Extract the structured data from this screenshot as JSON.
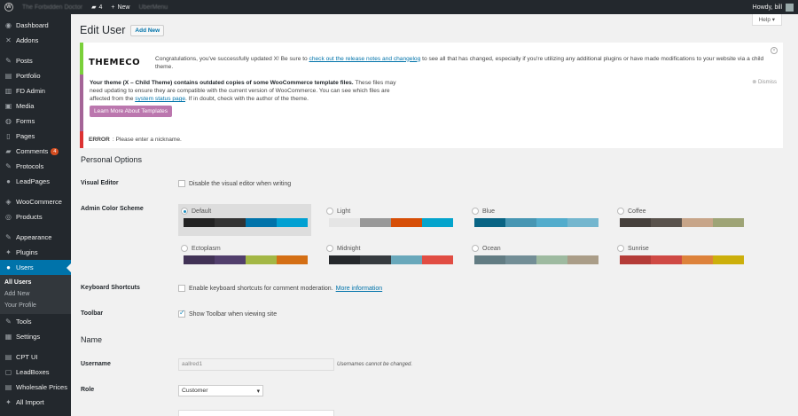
{
  "adminbar": {
    "site_name": "The Forbidden Doctor",
    "comments_count": "4",
    "new_label": "New",
    "blurred_item": "UberMenu",
    "greeting": "Howdy, bill"
  },
  "sidebar": {
    "items": [
      {
        "label": "Dashboard",
        "icon": "dashboard-icon",
        "glyph": "◉"
      },
      {
        "label": "Addons",
        "icon": "x-icon",
        "glyph": "✕"
      },
      {
        "label": "Posts",
        "icon": "pin-icon",
        "glyph": "✎"
      },
      {
        "label": "Portfolio",
        "icon": "portfolio-icon",
        "glyph": "▤"
      },
      {
        "label": "FD Admin",
        "icon": "fd-admin-icon",
        "glyph": "▥"
      },
      {
        "label": "Media",
        "icon": "media-icon",
        "glyph": "▣"
      },
      {
        "label": "Forms",
        "icon": "forms-icon",
        "glyph": "◍"
      },
      {
        "label": "Pages",
        "icon": "pages-icon",
        "glyph": "▯"
      },
      {
        "label": "Comments",
        "icon": "comments-icon",
        "glyph": "▰",
        "badge": "4"
      },
      {
        "label": "Protocols",
        "icon": "protocols-icon",
        "glyph": "✎"
      },
      {
        "label": "LeadPages",
        "icon": "leadpages-icon",
        "glyph": "●"
      },
      {
        "label": "WooCommerce",
        "icon": "woocommerce-icon",
        "glyph": "◈"
      },
      {
        "label": "Products",
        "icon": "products-icon",
        "glyph": "◎"
      },
      {
        "label": "Appearance",
        "icon": "appearance-icon",
        "glyph": "✎"
      },
      {
        "label": "Plugins",
        "icon": "plugins-icon",
        "glyph": "✦"
      },
      {
        "label": "Users",
        "icon": "users-icon",
        "glyph": "●"
      },
      {
        "label": "Tools",
        "icon": "tools-icon",
        "glyph": "✎"
      },
      {
        "label": "Settings",
        "icon": "settings-icon",
        "glyph": "▦"
      },
      {
        "label": "CPT UI",
        "icon": "cpt-ui-icon",
        "glyph": "▤"
      },
      {
        "label": "LeadBoxes",
        "icon": "leadboxes-icon",
        "glyph": "▢"
      },
      {
        "label": "Wholesale Prices",
        "icon": "wholesale-prices-icon",
        "glyph": "▤"
      },
      {
        "label": "All Import",
        "icon": "all-import-icon",
        "glyph": "✦"
      }
    ],
    "users_submenu": [
      "All Users",
      "Add New",
      "Your Profile"
    ]
  },
  "header": {
    "help_label": "Help ▾",
    "title": "Edit User",
    "add_new_label": "Add New"
  },
  "notices": {
    "theme": {
      "logo": "THEMECO",
      "text_before": "Congratulations, you've successfully updated X! Be sure to ",
      "link": "check out the release notes and changelog",
      "text_after": " to see all that has changed, especially if you're utilizing any additional plugins or have made modifications to your website via a child theme.",
      "close": "×"
    },
    "woo": {
      "bold": "Your theme (X – Child Theme) contains outdated copies of some WooCommerce template files.",
      "text1": " These files may need updating to ensure they are compatible with the current version of WooCommerce. You can see which files are affected from the ",
      "link": "system status page",
      "text2": ". If in doubt, check with the author of the theme.",
      "button": "Learn More About Templates",
      "dismiss": "⊗ Dismiss"
    },
    "error": {
      "label": "ERROR",
      "message": ": Please enter a nickname."
    }
  },
  "form": {
    "personal_options_heading": "Personal Options",
    "visual_editor_label": "Visual Editor",
    "visual_editor_text": "Disable the visual editor when writing",
    "color_scheme_label": "Admin Color Scheme",
    "schemes": [
      {
        "name": "Default",
        "selected": true,
        "colors": [
          "#222222",
          "#333333",
          "#0073aa",
          "#00a0d2"
        ]
      },
      {
        "name": "Light",
        "selected": false,
        "colors": [
          "#e5e5e5",
          "#999999",
          "#d64e07",
          "#04a4cc"
        ]
      },
      {
        "name": "Blue",
        "selected": false,
        "colors": [
          "#096484",
          "#4796b3",
          "#52accc",
          "#74b6ce"
        ]
      },
      {
        "name": "Coffee",
        "selected": false,
        "colors": [
          "#46403c",
          "#59524c",
          "#c7a589",
          "#9ea476"
        ]
      },
      {
        "name": "Ectoplasm",
        "selected": false,
        "colors": [
          "#413256",
          "#523f6d",
          "#a3b745",
          "#d46f15"
        ]
      },
      {
        "name": "Midnight",
        "selected": false,
        "colors": [
          "#25282b",
          "#363b3f",
          "#69a8bb",
          "#e14d43"
        ]
      },
      {
        "name": "Ocean",
        "selected": false,
        "colors": [
          "#627c83",
          "#738e96",
          "#9ebaa0",
          "#aa9d88"
        ]
      },
      {
        "name": "Sunrise",
        "selected": false,
        "colors": [
          "#b43c38",
          "#cf4944",
          "#dd823b",
          "#ccaf0b"
        ]
      }
    ],
    "keyboard_label": "Keyboard Shortcuts",
    "keyboard_text": "Enable keyboard shortcuts for comment moderation.",
    "keyboard_link": "More information",
    "toolbar_label": "Toolbar",
    "toolbar_text": "Show Toolbar when viewing site",
    "name_heading": "Name",
    "username_label": "Username",
    "username_value": "aallred1",
    "username_desc": "Usernames cannot be changed.",
    "role_label": "Role",
    "role_value": "Customer"
  }
}
